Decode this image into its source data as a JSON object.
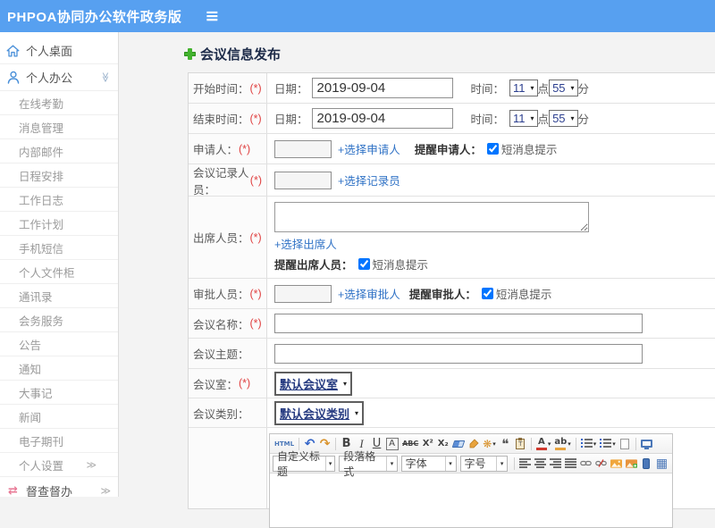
{
  "icons": {
    "hamburger": "≡",
    "chevron_double": "≫",
    "dropdown": "▾",
    "shuffle": "⇄"
  },
  "colors": {
    "header_blue": "#57a0f0",
    "link_blue": "#3173c6",
    "accent_green": "#43b32e",
    "required_red": "#e04343",
    "select_text_blue": "#2c3f8f",
    "sidebar_icon_blue": "#4a90d9"
  },
  "header": {
    "title": "PHPOA协同办公软件政务版"
  },
  "sidebar": {
    "items": [
      {
        "label": "个人桌面",
        "level": "top",
        "icon": "home-icon"
      },
      {
        "label": "个人办公",
        "level": "top",
        "icon": "user-icon",
        "expanded": true
      },
      {
        "label": "在线考勤",
        "level": "sub"
      },
      {
        "label": "消息管理",
        "level": "sub"
      },
      {
        "label": "内部邮件",
        "level": "sub"
      },
      {
        "label": "日程安排",
        "level": "sub"
      },
      {
        "label": "工作日志",
        "level": "sub"
      },
      {
        "label": "工作计划",
        "level": "sub"
      },
      {
        "label": "手机短信",
        "level": "sub"
      },
      {
        "label": "个人文件柜",
        "level": "sub"
      },
      {
        "label": "通讯录",
        "level": "sub"
      },
      {
        "label": "会务服务",
        "level": "sub"
      },
      {
        "label": "公告",
        "level": "sub"
      },
      {
        "label": "通知",
        "level": "sub"
      },
      {
        "label": "大事记",
        "level": "sub"
      },
      {
        "label": "新闻",
        "level": "sub"
      },
      {
        "label": "电子期刊",
        "level": "sub"
      },
      {
        "label": "个人设置",
        "level": "sub",
        "has_children": true
      },
      {
        "label": "督查督办",
        "level": "top",
        "icon": "shuffle-icon",
        "has_children": true
      }
    ]
  },
  "page": {
    "title": "会议信息发布"
  },
  "form": {
    "start_time": {
      "label": "开始时间：",
      "required": "(*)",
      "date_label": "日期：",
      "date_value": "2019-09-04",
      "time_label": "时间：",
      "hour": "11",
      "hour_unit": "点",
      "minute": "55",
      "minute_unit": "分"
    },
    "end_time": {
      "label": "结束时间：",
      "required": "(*)",
      "date_label": "日期：",
      "date_value": "2019-09-04",
      "time_label": "时间：",
      "hour": "11",
      "hour_unit": "点",
      "minute": "55",
      "minute_unit": "分"
    },
    "applicant": {
      "label": "申请人：",
      "required": "(*)",
      "value": "",
      "link": "+选择申请人",
      "remind_label": "提醒申请人：",
      "checkbox_label": "短消息提示",
      "checked": true
    },
    "recorder": {
      "label": "会议记录人员：",
      "required": "(*)",
      "value": "",
      "link": "+选择记录员"
    },
    "attendees": {
      "label": "出席人员：",
      "required": "(*)",
      "value": "",
      "link": "+选择出席人",
      "remind_label": "提醒出席人员：",
      "checkbox_label": "短消息提示",
      "checked": true
    },
    "approver": {
      "label": "审批人员：",
      "required": "(*)",
      "value": "",
      "link": "+选择审批人",
      "remind_label": "提醒审批人：",
      "checkbox_label": "短消息提示",
      "checked": true
    },
    "meeting_name": {
      "label": "会议名称：",
      "required": "(*)",
      "value": ""
    },
    "meeting_subject": {
      "label": "会议主题：",
      "value": ""
    },
    "meeting_room": {
      "label": "会议室：",
      "required": "(*)",
      "value": "默认会议室"
    },
    "meeting_category": {
      "label": "会议类别：",
      "value": "默认会议类别"
    }
  },
  "editor": {
    "buttons": {
      "html": "HTML",
      "undo": "↶",
      "redo": "↷",
      "bold": "B",
      "italic": "I",
      "underline": "U",
      "font_border": "A",
      "strikethrough": "ABC",
      "superscript": "X²",
      "subscript": "X₂",
      "blockquote": "❝",
      "autotypeset": "❋",
      "forecolor": "A",
      "backcolor": "ab",
      "table": "▦"
    },
    "selects": [
      {
        "label": "自定义标题"
      },
      {
        "label": "段落格式"
      },
      {
        "label": "字体"
      },
      {
        "label": "字号"
      }
    ]
  }
}
